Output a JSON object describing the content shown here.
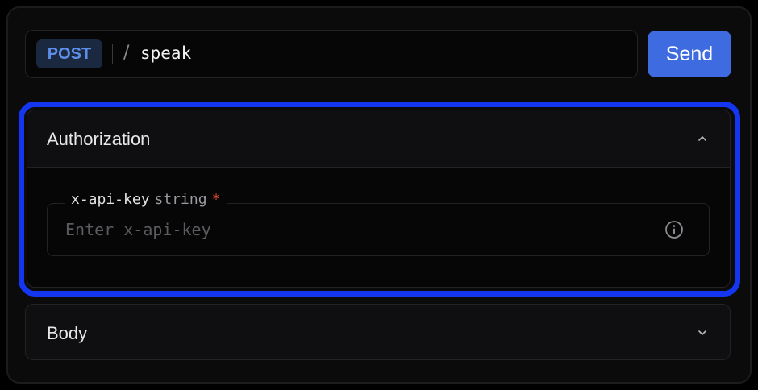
{
  "request": {
    "method": "POST",
    "separator": "/",
    "path": "speak",
    "send_label": "Send"
  },
  "authorization": {
    "title": "Authorization",
    "expanded": true,
    "field": {
      "name": "x-api-key",
      "type": "string",
      "required_marker": "*",
      "placeholder": "Enter x-api-key",
      "value": ""
    }
  },
  "body": {
    "title": "Body",
    "expanded": false
  },
  "icons": {
    "auth_toggle": "chevron-up-icon",
    "body_toggle": "chevron-down-icon",
    "field_info": "info-icon"
  },
  "colors": {
    "method_badge": "#5d8ee8",
    "send_button": "#3f6be0",
    "highlight": "#1436f0",
    "required": "#e24c3a"
  }
}
